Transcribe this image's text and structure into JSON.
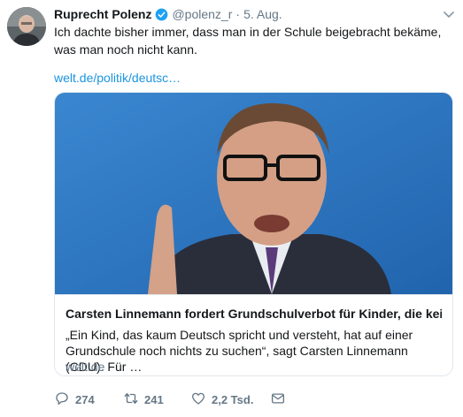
{
  "tweet": {
    "author_name": "Ruprecht Polenz",
    "handle": "@polenz_r",
    "separator": "·",
    "date": "5. Aug.",
    "text": "Ich dachte bisher immer, dass man in der Schule beigebracht bekäme, was man noch nicht kann.",
    "link_text": "welt.de/politik/deutsc…"
  },
  "card": {
    "title": "Carsten Linnemann fordert Grundschulverbot für Kinder, die kein De…",
    "description": "„Ein Kind, das kaum Deutsch spricht und versteht, hat auf einer Grundschule noch nichts zu suchen“, sagt Carsten Linnemann (CDU). Für …",
    "domain": "welt.de"
  },
  "actions": {
    "replies": "274",
    "retweets": "241",
    "likes": "2,2 Tsd."
  },
  "colors": {
    "link": "#1b95e0",
    "secondary_text": "#657786",
    "verified": "#1da1f2"
  }
}
